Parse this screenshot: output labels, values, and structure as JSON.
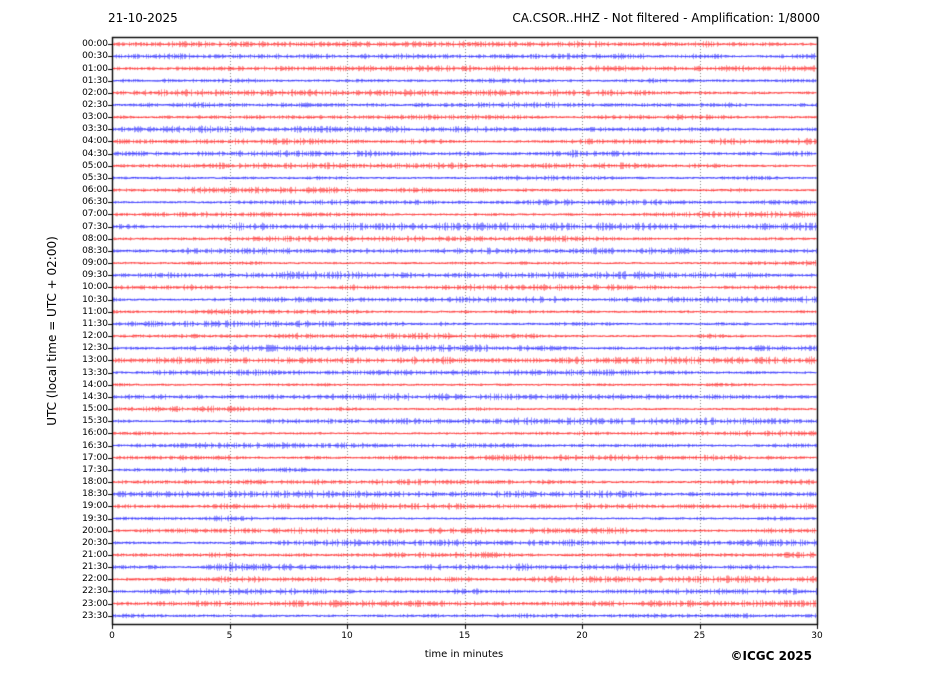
{
  "header": {
    "date": "21-10-2025",
    "station_title": "CA.CSOR..HHZ - Not filtered - Amplification: 1/8000"
  },
  "footer": {
    "copyright": "©ICGC 2025"
  },
  "chart_data": {
    "type": "line",
    "subtype": "helicorder-dayplot",
    "title": "CA.CSOR..HHZ - Not filtered - Amplification: 1/8000",
    "date": "21-10-2025",
    "xlabel": "time in minutes",
    "ylabel": "UTC (local time = UTC + 02:00)",
    "xlim": [
      0,
      30
    ],
    "x_ticks": [
      0,
      5,
      10,
      15,
      20,
      25,
      30
    ],
    "minutes_per_row": 30,
    "grid": {
      "vertical_dotted_at_minutes": [
        5,
        10,
        15,
        20,
        25
      ],
      "color": "#888888",
      "style": "dotted"
    },
    "legend_position": "none",
    "colors": {
      "hour_trace": "#ff0000",
      "half_hour_trace": "#0000ff",
      "frame": "#000000"
    },
    "description": "Continuous background-noise seismogram; 48 half-hour rows, flat noisy traces, no visible seismic events",
    "traces": [
      {
        "label": "00:00",
        "color": "#ff0000",
        "amp": 1.0
      },
      {
        "label": "00:30",
        "color": "#0000ff",
        "amp": 1.1
      },
      {
        "label": "01:00",
        "color": "#ff0000",
        "amp": 1.0
      },
      {
        "label": "01:30",
        "color": "#0000ff",
        "amp": 1.2
      },
      {
        "label": "02:00",
        "color": "#ff0000",
        "amp": 1.1
      },
      {
        "label": "02:30",
        "color": "#0000ff",
        "amp": 1.0
      },
      {
        "label": "03:00",
        "color": "#ff0000",
        "amp": 1.0
      },
      {
        "label": "03:30",
        "color": "#0000ff",
        "amp": 1.1
      },
      {
        "label": "04:00",
        "color": "#ff0000",
        "amp": 1.2
      },
      {
        "label": "04:30",
        "color": "#0000ff",
        "amp": 1.3
      },
      {
        "label": "05:00",
        "color": "#ff0000",
        "amp": 1.0
      },
      {
        "label": "05:30",
        "color": "#0000ff",
        "amp": 1.1
      },
      {
        "label": "06:00",
        "color": "#ff0000",
        "amp": 1.0
      },
      {
        "label": "06:30",
        "color": "#0000ff",
        "amp": 1.0
      },
      {
        "label": "07:00",
        "color": "#ff0000",
        "amp": 1.1
      },
      {
        "label": "07:30",
        "color": "#0000ff",
        "amp": 1.3
      },
      {
        "label": "08:00",
        "color": "#ff0000",
        "amp": 1.0
      },
      {
        "label": "08:30",
        "color": "#0000ff",
        "amp": 1.1
      },
      {
        "label": "09:00",
        "color": "#ff0000",
        "amp": 1.0
      },
      {
        "label": "09:30",
        "color": "#0000ff",
        "amp": 1.3
      },
      {
        "label": "10:00",
        "color": "#ff0000",
        "amp": 1.2
      },
      {
        "label": "10:30",
        "color": "#0000ff",
        "amp": 1.1
      },
      {
        "label": "11:00",
        "color": "#ff0000",
        "amp": 1.0
      },
      {
        "label": "11:30",
        "color": "#0000ff",
        "amp": 1.1
      },
      {
        "label": "12:00",
        "color": "#ff0000",
        "amp": 1.0
      },
      {
        "label": "12:30",
        "color": "#0000ff",
        "amp": 1.1
      },
      {
        "label": "13:00",
        "color": "#ff0000",
        "amp": 1.2
      },
      {
        "label": "13:30",
        "color": "#0000ff",
        "amp": 1.0
      },
      {
        "label": "14:00",
        "color": "#ff0000",
        "amp": 1.0
      },
      {
        "label": "14:30",
        "color": "#0000ff",
        "amp": 1.1
      },
      {
        "label": "15:00",
        "color": "#ff0000",
        "amp": 1.0
      },
      {
        "label": "15:30",
        "color": "#0000ff",
        "amp": 1.1
      },
      {
        "label": "16:00",
        "color": "#ff0000",
        "amp": 1.0
      },
      {
        "label": "16:30",
        "color": "#0000ff",
        "amp": 1.0
      },
      {
        "label": "17:00",
        "color": "#ff0000",
        "amp": 1.1
      },
      {
        "label": "17:30",
        "color": "#0000ff",
        "amp": 1.0
      },
      {
        "label": "18:00",
        "color": "#ff0000",
        "amp": 1.1
      },
      {
        "label": "18:30",
        "color": "#0000ff",
        "amp": 1.2
      },
      {
        "label": "19:00",
        "color": "#ff0000",
        "amp": 1.1
      },
      {
        "label": "19:30",
        "color": "#0000ff",
        "amp": 1.0
      },
      {
        "label": "20:00",
        "color": "#ff0000",
        "amp": 1.0
      },
      {
        "label": "20:30",
        "color": "#0000ff",
        "amp": 1.1
      },
      {
        "label": "21:00",
        "color": "#ff0000",
        "amp": 1.0
      },
      {
        "label": "21:30",
        "color": "#0000ff",
        "amp": 1.4
      },
      {
        "label": "22:00",
        "color": "#ff0000",
        "amp": 1.1
      },
      {
        "label": "22:30",
        "color": "#0000ff",
        "amp": 1.0
      },
      {
        "label": "23:00",
        "color": "#ff0000",
        "amp": 1.1
      },
      {
        "label": "23:30",
        "color": "#0000ff",
        "amp": 1.2
      }
    ]
  }
}
